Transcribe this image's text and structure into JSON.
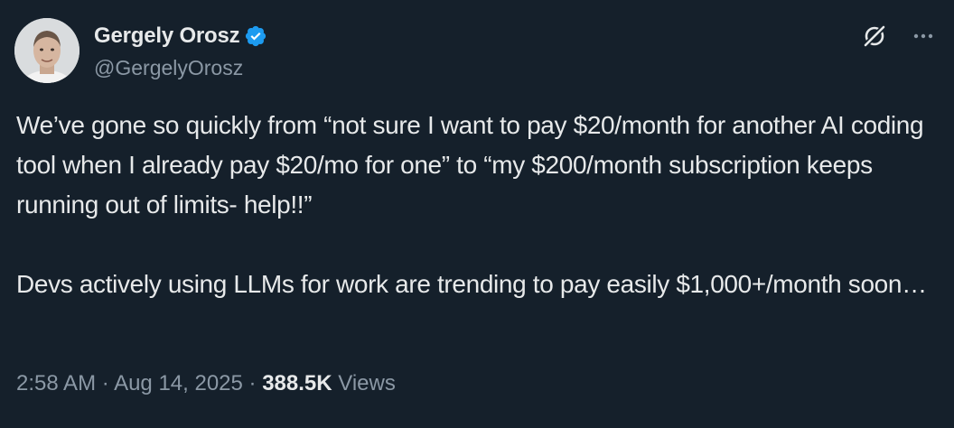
{
  "author": {
    "name": "Gergely Orosz",
    "handle": "@GergelyOrosz",
    "verified_color": "#1d9bf0"
  },
  "icons": {
    "avatar": "avatar-photo",
    "verified": "verified-badge-icon",
    "grok": "grok-icon",
    "more": "more-icon"
  },
  "tweet": {
    "paragraphs": [
      "We’ve gone so quickly from “not sure I want to pay $20/month for another AI coding tool when I already pay $20/mo for one” to “my $200/month subscription keeps running out of limits- help!!”",
      "Devs actively using LLMs for work are trending to pay easily $1,000+/month soon…"
    ]
  },
  "meta": {
    "time": "2:58 AM",
    "separator": " · ",
    "date": "Aug 14, 2025",
    "views_count": "388.5K",
    "views_label": " Views"
  },
  "colors": {
    "background": "#15202b",
    "text_primary": "#e7e9ea",
    "text_secondary": "#8b98a5"
  }
}
